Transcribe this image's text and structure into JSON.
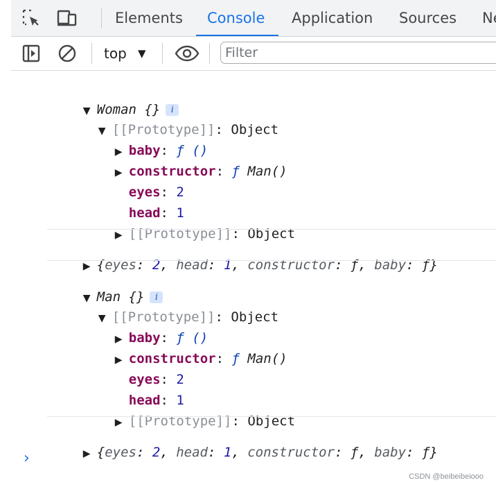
{
  "devtools": {
    "tabs": [
      "Elements",
      "Console",
      "Application",
      "Sources",
      "Ne"
    ],
    "active_tab": "Console",
    "accent_color": "#1a73e8"
  },
  "toolbar": {
    "context": "top",
    "filter_placeholder": "Filter"
  },
  "console": {
    "entries": [
      {
        "title": "Woman {}",
        "info": "i",
        "prototype_label": "[[Prototype]]",
        "prototype_type": "Object",
        "props": [
          {
            "key": "baby",
            "value": "ƒ ()"
          },
          {
            "key": "constructor",
            "f": "ƒ",
            "value": "Man()"
          },
          {
            "key": "eyes",
            "value": "2"
          },
          {
            "key": "head",
            "value": "1"
          }
        ],
        "inner_prototype_label": "[[Prototype]]",
        "inner_prototype_type": "Object",
        "summary": {
          "open": "{",
          "k1": "eyes",
          "v1": "2",
          "k2": "head",
          "v2": "1",
          "k3": "constructor",
          "v3": "ƒ",
          "k4": "baby",
          "v4": "ƒ",
          "close": "}"
        }
      },
      {
        "title": "Man {}",
        "info": "i",
        "prototype_label": "[[Prototype]]",
        "prototype_type": "Object",
        "props": [
          {
            "key": "baby",
            "value": "ƒ ()"
          },
          {
            "key": "constructor",
            "f": "ƒ",
            "value": "Man()"
          },
          {
            "key": "eyes",
            "value": "2"
          },
          {
            "key": "head",
            "value": "1"
          }
        ],
        "inner_prototype_label": "[[Prototype]]",
        "inner_prototype_type": "Object",
        "summary": {
          "open": "{",
          "k1": "eyes",
          "v1": "2",
          "k2": "head",
          "v2": "1",
          "k3": "constructor",
          "v3": "ƒ",
          "k4": "baby",
          "v4": "ƒ",
          "close": "}"
        }
      }
    ],
    "prompt": "›"
  },
  "watermark": "CSDN @beibeibeiooo"
}
